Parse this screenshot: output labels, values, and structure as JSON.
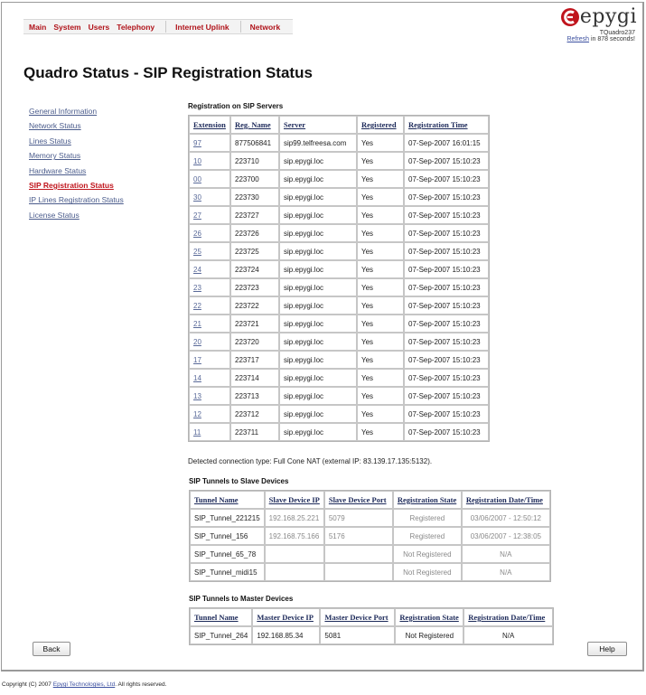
{
  "topnav": {
    "items": [
      "Main",
      "System",
      "Users",
      "Telephony",
      "Internet Uplink",
      "Network"
    ]
  },
  "brand": {
    "logo_text": "epygi",
    "model": "TQuadro237",
    "refresh_link": "Refresh",
    "refresh_suffix": " in 878 seconds!",
    "accent": "#c0141c"
  },
  "page_title": "Quadro Status - SIP Registration Status",
  "sidebar": {
    "items": [
      {
        "label": "General Information"
      },
      {
        "label": "Network Status"
      },
      {
        "label": "Lines Status"
      },
      {
        "label": "Memory Status"
      },
      {
        "label": "Hardware Status"
      },
      {
        "label": "SIP Registration Status"
      },
      {
        "label": "IP Lines Registration Status"
      },
      {
        "label": "License Status"
      }
    ],
    "active_index": 5
  },
  "registration": {
    "title": "Registration on SIP Servers",
    "headers": [
      "Extension",
      "Reg. Name",
      "Server",
      "Registered",
      "Registration Time"
    ],
    "rows": [
      [
        "97",
        "877506841",
        "sip99.telfreesa.com",
        "Yes",
        "07-Sep-2007 16:01:15"
      ],
      [
        "10",
        "223710",
        "sip.epygi.loc",
        "Yes",
        "07-Sep-2007 15:10:23"
      ],
      [
        "00",
        "223700",
        "sip.epygi.loc",
        "Yes",
        "07-Sep-2007 15:10:23"
      ],
      [
        "30",
        "223730",
        "sip.epygi.loc",
        "Yes",
        "07-Sep-2007 15:10:23"
      ],
      [
        "27",
        "223727",
        "sip.epygi.loc",
        "Yes",
        "07-Sep-2007 15:10:23"
      ],
      [
        "26",
        "223726",
        "sip.epygi.loc",
        "Yes",
        "07-Sep-2007 15:10:23"
      ],
      [
        "25",
        "223725",
        "sip.epygi.loc",
        "Yes",
        "07-Sep-2007 15:10:23"
      ],
      [
        "24",
        "223724",
        "sip.epygi.loc",
        "Yes",
        "07-Sep-2007 15:10:23"
      ],
      [
        "23",
        "223723",
        "sip.epygi.loc",
        "Yes",
        "07-Sep-2007 15:10:23"
      ],
      [
        "22",
        "223722",
        "sip.epygi.loc",
        "Yes",
        "07-Sep-2007 15:10:23"
      ],
      [
        "21",
        "223721",
        "sip.epygi.loc",
        "Yes",
        "07-Sep-2007 15:10:23"
      ],
      [
        "20",
        "223720",
        "sip.epygi.loc",
        "Yes",
        "07-Sep-2007 15:10:23"
      ],
      [
        "17",
        "223717",
        "sip.epygi.loc",
        "Yes",
        "07-Sep-2007 15:10:23"
      ],
      [
        "14",
        "223714",
        "sip.epygi.loc",
        "Yes",
        "07-Sep-2007 15:10:23"
      ],
      [
        "13",
        "223713",
        "sip.epygi.loc",
        "Yes",
        "07-Sep-2007 15:10:23"
      ],
      [
        "12",
        "223712",
        "sip.epygi.loc",
        "Yes",
        "07-Sep-2007 15:10:23"
      ],
      [
        "11",
        "223711",
        "sip.epygi.loc",
        "Yes",
        "07-Sep-2007 15:10:23"
      ]
    ]
  },
  "nat_text": "Detected connection type: Full Cone NAT (external IP: 83.139.17.135:5132).",
  "slave_tunnels": {
    "title": "SIP Tunnels  to Slave Devices",
    "headers": [
      "Tunnel Name",
      "Slave Device IP",
      "Slave Device Port",
      "Registration State",
      "Registration Date/Time"
    ],
    "rows": [
      [
        "SIP_Tunnel_221215",
        "192.168.25.221",
        "5079",
        "Registered",
        "03/06/2007 - 12:50:12"
      ],
      [
        "SIP_Tunnel_156",
        "192.168.75.166",
        "5176",
        "Registered",
        "03/06/2007 - 12:38:05"
      ],
      [
        "SIP_Tunnel_65_78",
        "",
        "",
        "Not Registered",
        "N/A"
      ],
      [
        "SIP_Tunnel_midi15",
        "",
        "",
        "Not Registered",
        "N/A"
      ]
    ]
  },
  "master_tunnels": {
    "title": "SIP Tunnels to Master Devices",
    "headers": [
      "Tunnel Name",
      "Master Device IP",
      "Master Device Port",
      "Registration State",
      "Registration Date/Time"
    ],
    "rows": [
      [
        "SIP_Tunnel_264",
        "192.168.85.34",
        "5081",
        "Not Registered",
        "N/A"
      ]
    ]
  },
  "buttons": {
    "back": "Back",
    "help": "Help"
  },
  "footer": {
    "prefix": "Copyright (C) 2007 ",
    "company": "Epygi Technologies, Ltd",
    "suffix": ". All rights reserved."
  }
}
